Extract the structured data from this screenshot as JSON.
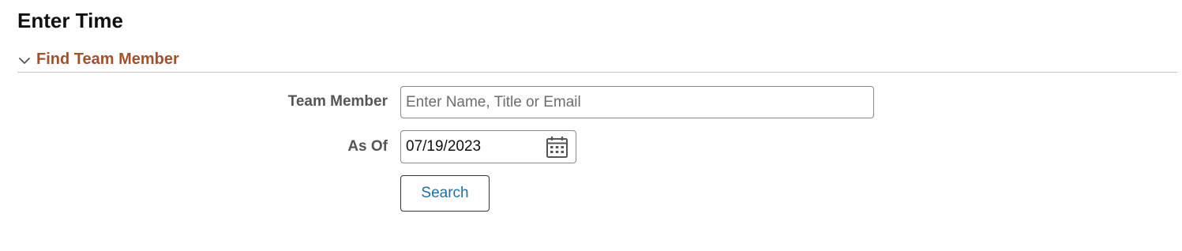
{
  "page": {
    "title": "Enter Time"
  },
  "section": {
    "title": "Find Team Member",
    "expanded": true,
    "title_color": "#a0522d"
  },
  "form": {
    "team_member": {
      "label": "Team Member",
      "value": "",
      "placeholder": "Enter Name, Title or Email"
    },
    "as_of": {
      "label": "As Of",
      "value": "07/19/2023",
      "icon": "calendar-icon"
    },
    "search_button": {
      "label": "Search",
      "color": "#1a6fa8"
    }
  }
}
